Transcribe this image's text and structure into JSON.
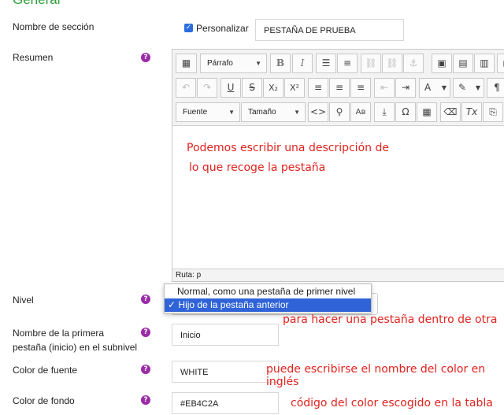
{
  "section_heading": "General",
  "section_name": {
    "label": "Nombre de sección",
    "customize_label": "Personalizar",
    "customize_checked": true,
    "value": "PESTAÑA DE PRUEBA"
  },
  "summary": {
    "label": "Resumen",
    "toolbar_row1": {
      "paragraph_select": "Párrafo",
      "bold": "B",
      "italic": "I"
    },
    "toolbar_row2": {
      "underline": "U",
      "strikethrough": "S",
      "subscript": "X₂",
      "superscript": "X²"
    },
    "toolbar_row3": {
      "font_select": "Fuente",
      "size_select": "Tamaño"
    },
    "path_label": "Ruta: p"
  },
  "level": {
    "label": "Nivel",
    "options": [
      "Normal, como una pestaña de primer nivel",
      "Hijo de la pestaña anterior"
    ],
    "selected_index": 1,
    "check_mark": "✓"
  },
  "first_tab_name": {
    "label_line1": "Nombre de la primera",
    "label_line2": "pestaña (inicio) en el subnivel",
    "value": "Inicio"
  },
  "font_color": {
    "label": "Color de fuente",
    "value": "WHITE"
  },
  "background_color": {
    "label": "Color de fondo",
    "value": "#EB4C2A"
  },
  "annotations": {
    "description_line1": "Podemos escribir una descripción de",
    "description_line2": "lo que recoge la pestaña",
    "nested_tab": "para hacer una pestaña dentro de otra",
    "color_name": "puede escribirse el nombre del color en inglés",
    "color_code": "código del color escogido en la tabla"
  },
  "help_icon_glyph": "?",
  "colors": {
    "heading": "#2e9e3b",
    "help_icon": "#9b2ba8",
    "selection": "#2f63d7",
    "annotation": "#e0231f"
  }
}
